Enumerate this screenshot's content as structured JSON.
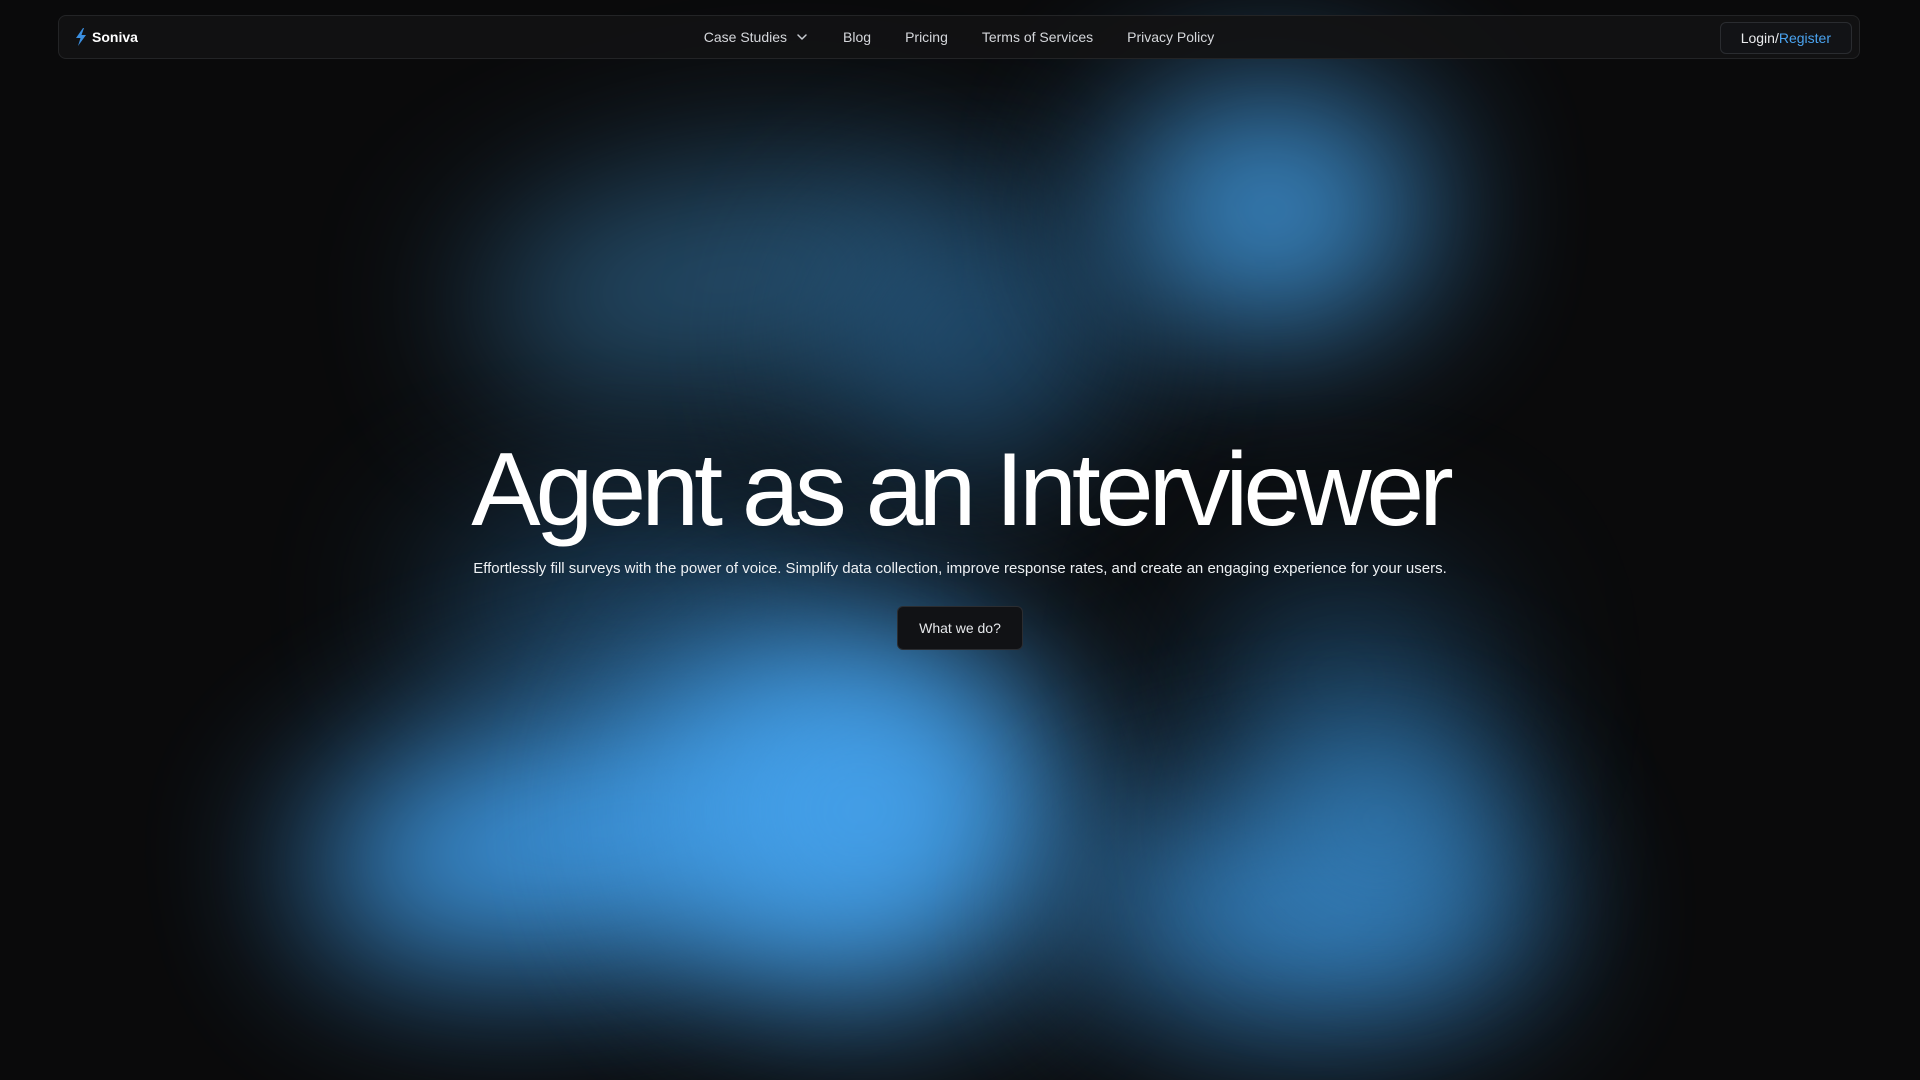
{
  "brand": {
    "name": "Soniva",
    "icon": "bolt-logo-icon",
    "accent": "#3b8fe0"
  },
  "nav": {
    "links": [
      {
        "label": "Case Studies",
        "has_dropdown": true
      },
      {
        "label": "Blog"
      },
      {
        "label": "Pricing"
      },
      {
        "label": "Terms of Services"
      },
      {
        "label": "Privacy Policy"
      }
    ],
    "login_label": "Login/",
    "register_label": " Register"
  },
  "hero": {
    "title": "Agent as an Interviewer",
    "subtitle": "Effortlessly fill surveys with the power of voice. Simplify data collection, improve response rates, and create an engaging experience for your users.",
    "cta_label": "What we do?"
  },
  "colors": {
    "background": "#0a0a0b",
    "blob": "#45a3ee",
    "link_accent": "#4aa3ef"
  }
}
